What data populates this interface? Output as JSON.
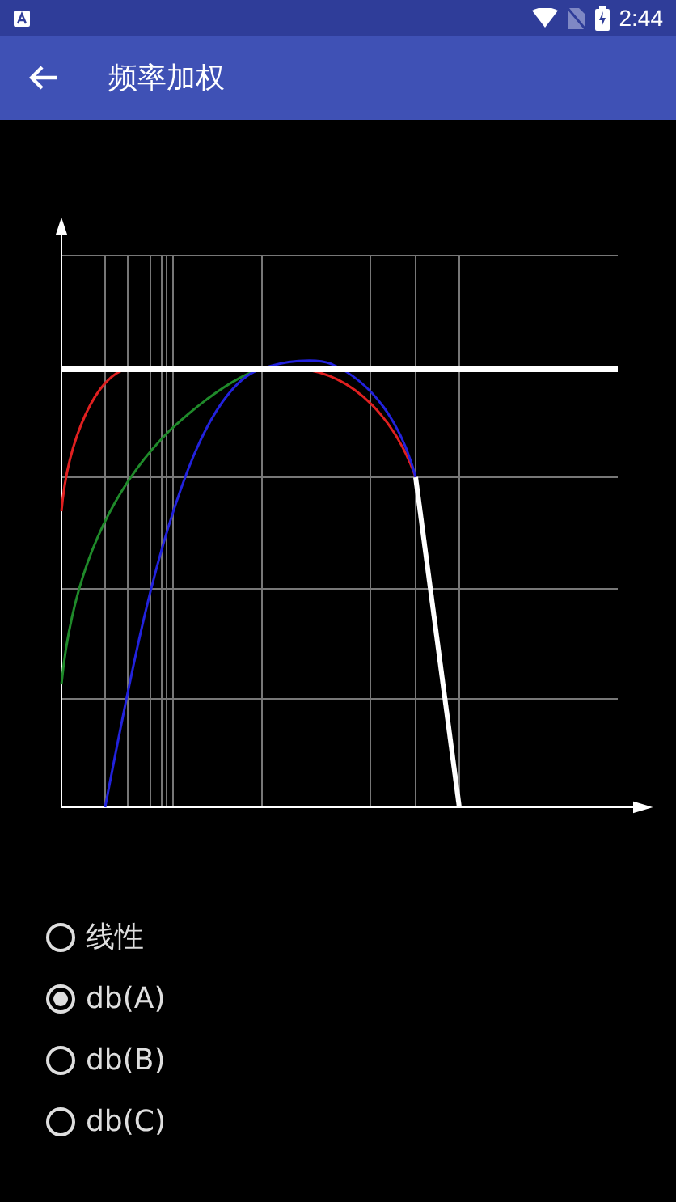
{
  "status_bar": {
    "time": "2:44"
  },
  "toolbar": {
    "title": "频率加权"
  },
  "options": [
    {
      "label": "线性",
      "selected": false
    },
    {
      "label": "db(A)",
      "selected": true
    },
    {
      "label": "db(B)",
      "selected": false
    },
    {
      "label": "db(C)",
      "selected": false
    }
  ]
}
